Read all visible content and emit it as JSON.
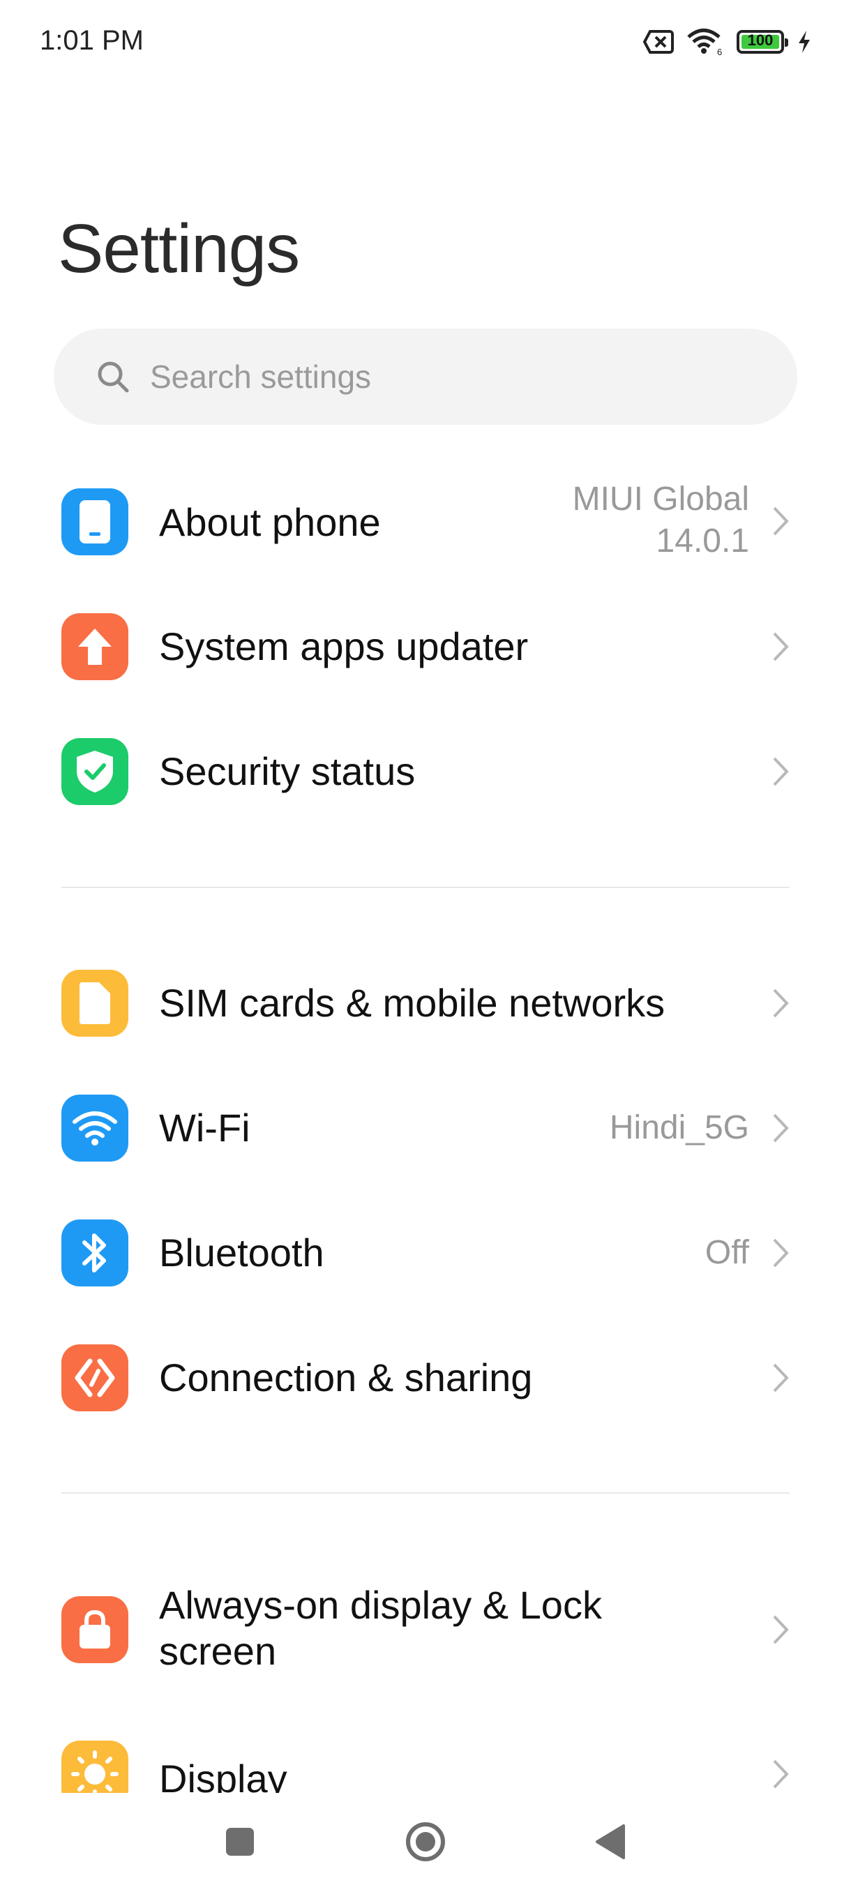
{
  "status_bar": {
    "time": "1:01 PM",
    "battery_level": "100",
    "icons": [
      "no-sim-icon",
      "wifi-6-icon",
      "battery-icon",
      "charging-icon"
    ]
  },
  "page": {
    "title": "Settings"
  },
  "search": {
    "placeholder": "Search settings"
  },
  "sections": [
    {
      "items": [
        {
          "label": "About phone",
          "value_line1": "MIUI Global",
          "value_line2": "14.0.1",
          "icon": "phone-icon",
          "color": "#1e9af5"
        },
        {
          "label": "System apps updater",
          "icon": "upload-arrow-icon",
          "color": "#f96e44"
        },
        {
          "label": "Security status",
          "icon": "shield-check-icon",
          "color": "#1ccb6a"
        }
      ]
    },
    {
      "items": [
        {
          "label": "SIM cards & mobile networks",
          "icon": "sim-card-icon",
          "color": "#fdbb3a"
        },
        {
          "label": "Wi-Fi",
          "value": "Hindi_5G",
          "icon": "wifi-icon",
          "color": "#1e9af5"
        },
        {
          "label": "Bluetooth",
          "value": "Off",
          "icon": "bluetooth-icon",
          "color": "#1e9af5"
        },
        {
          "label": "Connection & sharing",
          "icon": "connection-sharing-icon",
          "color": "#f96e44"
        }
      ]
    },
    {
      "items": [
        {
          "label_line1": "Always-on display & Lock",
          "label_line2": "screen",
          "icon": "lock-icon",
          "color": "#f96e44"
        },
        {
          "label": "Display",
          "icon": "sun-icon",
          "color": "#fdbb3a"
        }
      ]
    }
  ],
  "nav_bar": {
    "buttons": [
      "recents-square-icon",
      "home-circle-icon",
      "back-triangle-icon"
    ]
  }
}
